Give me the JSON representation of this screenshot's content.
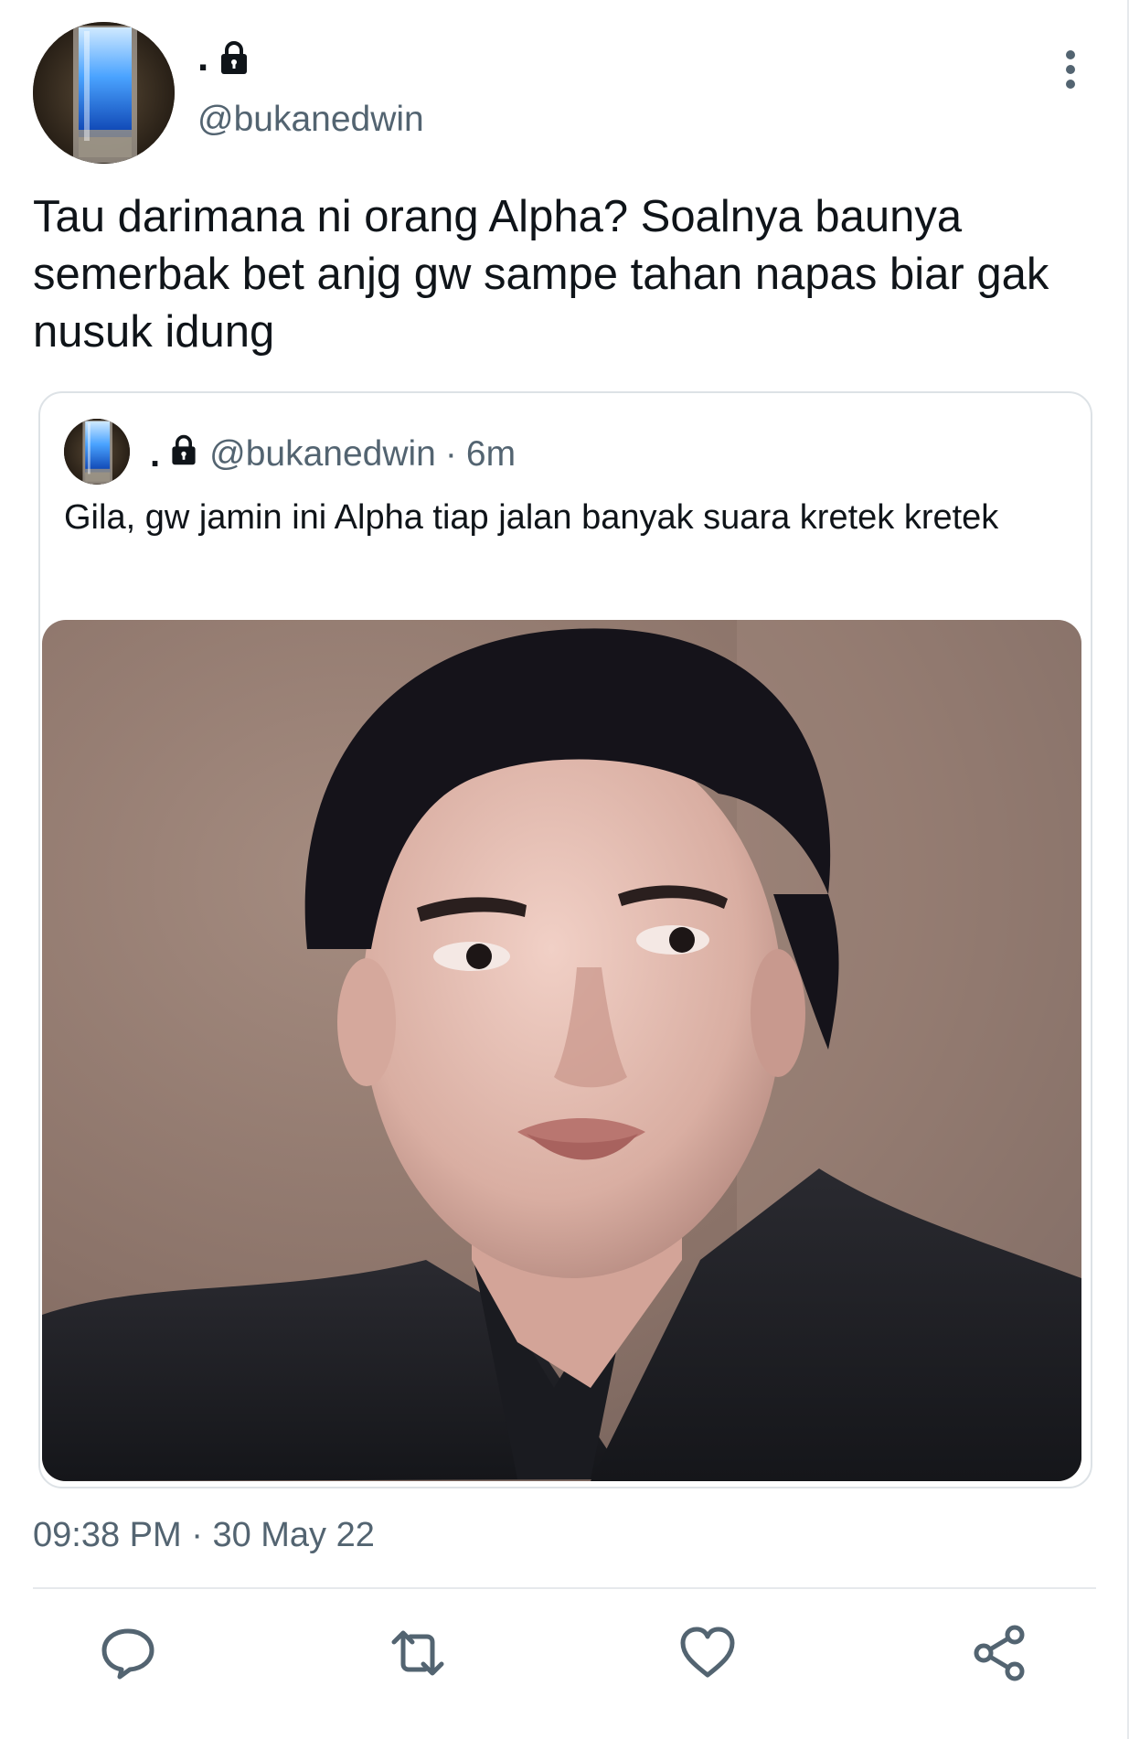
{
  "tweet": {
    "display_name": ".",
    "handle": "@bukanedwin",
    "text": "Tau darimana ni orang Alpha? Soalnya baunya semerbak bet anjg gw sampe tahan napas biar gak nusuk idung",
    "time": "09:38 PM",
    "separator": "·",
    "date": "30 May 22"
  },
  "quote": {
    "display_name": ".",
    "handle": "@bukanedwin",
    "separator": "·",
    "age": "6m",
    "text": "Gila, gw jamin ini Alpha tiap jalan banyak suara kretek kretek",
    "photo_icon": "portrait-photo"
  },
  "icons": {
    "lock": "lock-icon",
    "more": "more-vertical-icon",
    "reply": "reply-icon",
    "retweet": "retweet-icon",
    "like": "heart-icon",
    "share": "share-icon"
  },
  "colors": {
    "text": "#0f1419",
    "secondary": "#536471",
    "border": "#dde2e6"
  }
}
